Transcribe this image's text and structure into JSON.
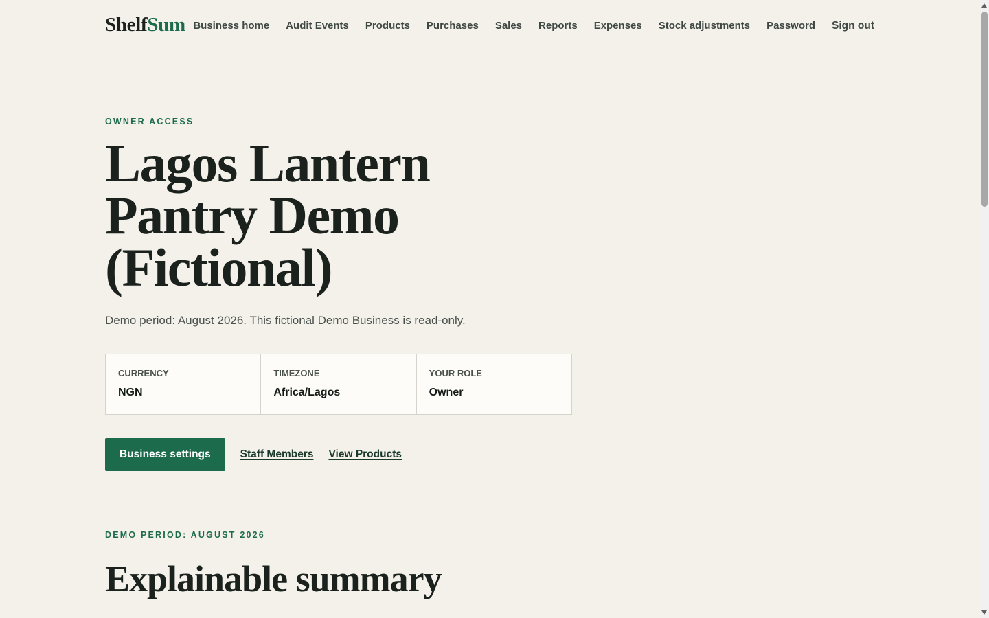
{
  "brand": {
    "name_prefix": "Shelf",
    "name_accent": "Sum"
  },
  "nav": {
    "items": [
      {
        "label": "Business home"
      },
      {
        "label": "Audit Events"
      },
      {
        "label": "Products"
      },
      {
        "label": "Purchases"
      },
      {
        "label": "Sales"
      },
      {
        "label": "Reports"
      },
      {
        "label": "Expenses"
      },
      {
        "label": "Stock adjustments"
      },
      {
        "label": "Password"
      }
    ],
    "sign_out": "Sign out"
  },
  "hero": {
    "eyebrow": "OWNER ACCESS",
    "title": "Lagos Lantern Pantry Demo (Fictional)",
    "subtitle": "Demo period: August 2026. This fictional Demo Business is read-only."
  },
  "info": [
    {
      "label": "CURRENCY",
      "value": "NGN"
    },
    {
      "label": "TIMEZONE",
      "value": "Africa/Lagos"
    },
    {
      "label": "YOUR ROLE",
      "value": "Owner"
    }
  ],
  "actions": {
    "primary": "Business settings",
    "staff_link": "Staff Members",
    "products_link": "View Products"
  },
  "summary": {
    "eyebrow": "DEMO PERIOD: AUGUST 2026",
    "title": "Explainable summary"
  },
  "colors": {
    "background": "#f4f1eb",
    "accent": "#1c6b4c",
    "text": "#1b221e"
  }
}
